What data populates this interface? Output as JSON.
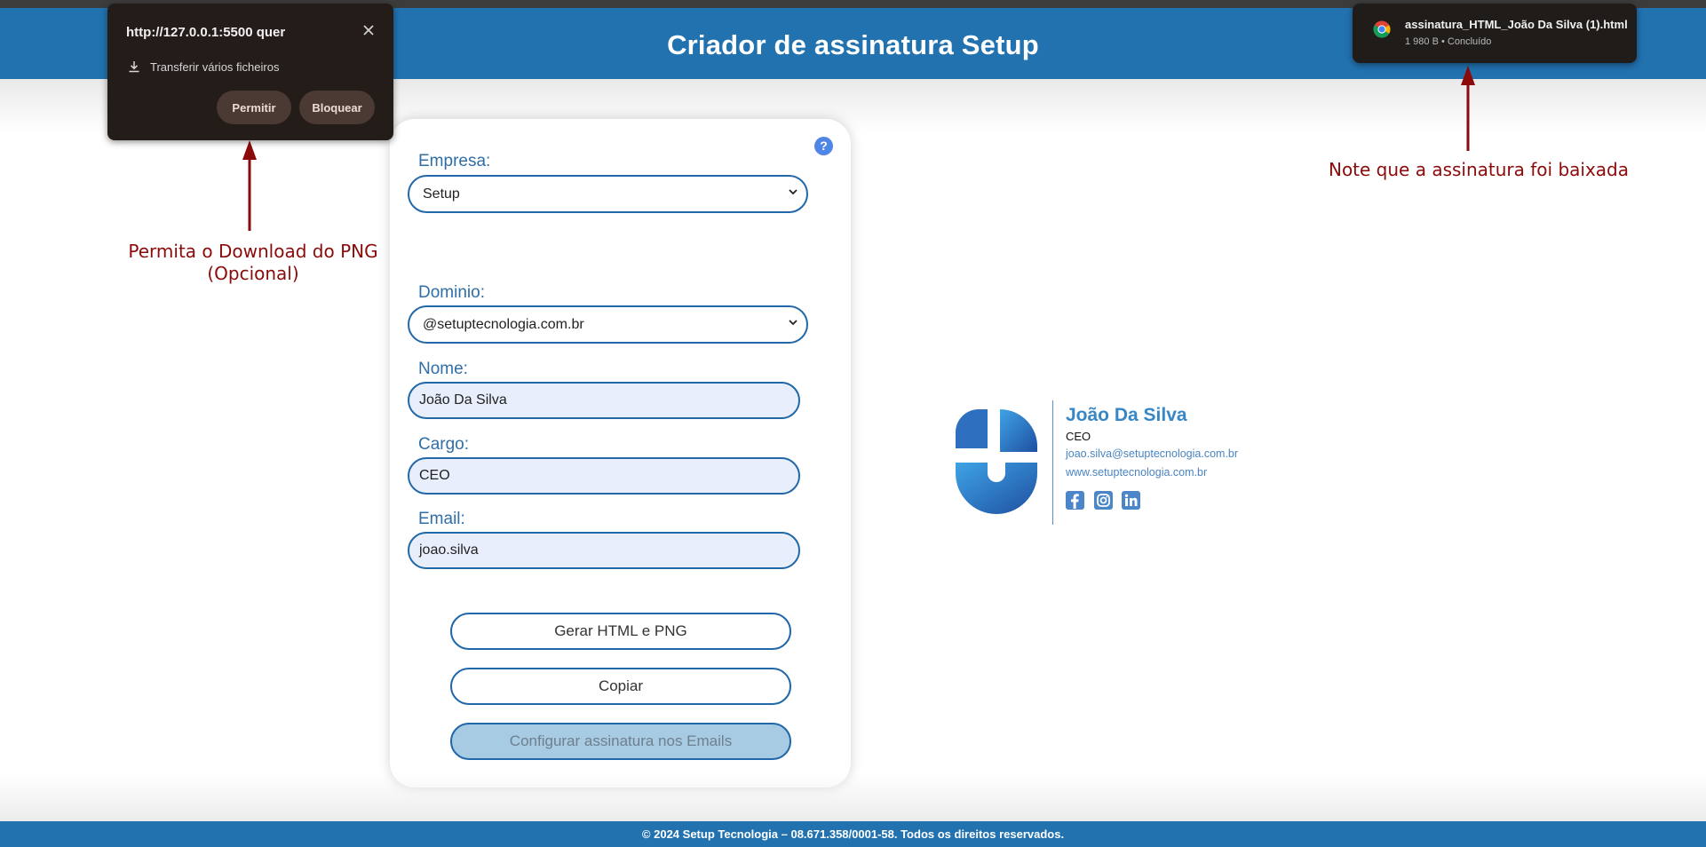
{
  "header": {
    "title": "Criador de assinatura Setup"
  },
  "form": {
    "help_label": "?",
    "empresa": {
      "label": "Empresa:",
      "value": "Setup"
    },
    "dominio": {
      "label": "Dominio:",
      "value": "@setuptecnologia.com.br"
    },
    "nome": {
      "label": "Nome:",
      "value": "João Da Silva"
    },
    "cargo": {
      "label": "Cargo:",
      "value": "CEO"
    },
    "email": {
      "label": "Email:",
      "value": "joao.silva"
    },
    "buttons": {
      "generate": "Gerar HTML e PNG",
      "copy": "Copiar",
      "configure": "Configurar assinatura nos Emails"
    }
  },
  "signature": {
    "name": "João Da Silva",
    "role": "CEO",
    "email": "joao.silva@setuptecnologia.com.br",
    "website": "www.setuptecnologia.com.br",
    "social_icons": [
      "facebook-icon",
      "instagram-icon",
      "linkedin-icon"
    ]
  },
  "permission_popup": {
    "title": "http://127.0.0.1:5500 quer",
    "message": "Transferir vários ficheiros",
    "allow": "Permitir",
    "block": "Bloquear"
  },
  "download_toast": {
    "filename": "assinatura_HTML_João Da Silva (1).html",
    "status": "1 980 B • Concluído"
  },
  "annotations": {
    "left_line1": "Permita o Download do PNG",
    "left_line2": "(Opcional)",
    "right": "Note que a assinatura foi baixada"
  },
  "footer": {
    "text": "© 2024 Setup Tecnologia – 08.671.358/0001-58. Todos os direitos reservados."
  },
  "colors": {
    "header_bg": "#2272b0",
    "accent": "#2068a8",
    "annotation": "#8b0a0a",
    "popup_bg": "#231c19"
  }
}
